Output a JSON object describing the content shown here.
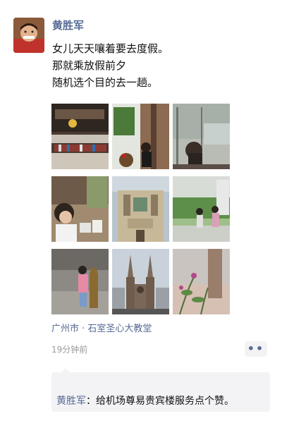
{
  "post": {
    "author": "黄胜军",
    "lines": [
      "女儿天天嚷着要去度假。",
      "那就乘放假前夕",
      "随机选个目的去一趟。"
    ],
    "location": "广州市 · 石室圣心大教堂",
    "timestamp": "19分钟前",
    "more_label": "••"
  },
  "comments": [
    {
      "author": "黄胜军",
      "separator": "：",
      "text": "给机场尊易贵宾楼服务点个赞。"
    }
  ],
  "colors": {
    "link": "#576b95",
    "comment_bg": "#f3f3f5"
  },
  "icons": {
    "avatar": "user-avatar",
    "more": "more-options-icon"
  }
}
